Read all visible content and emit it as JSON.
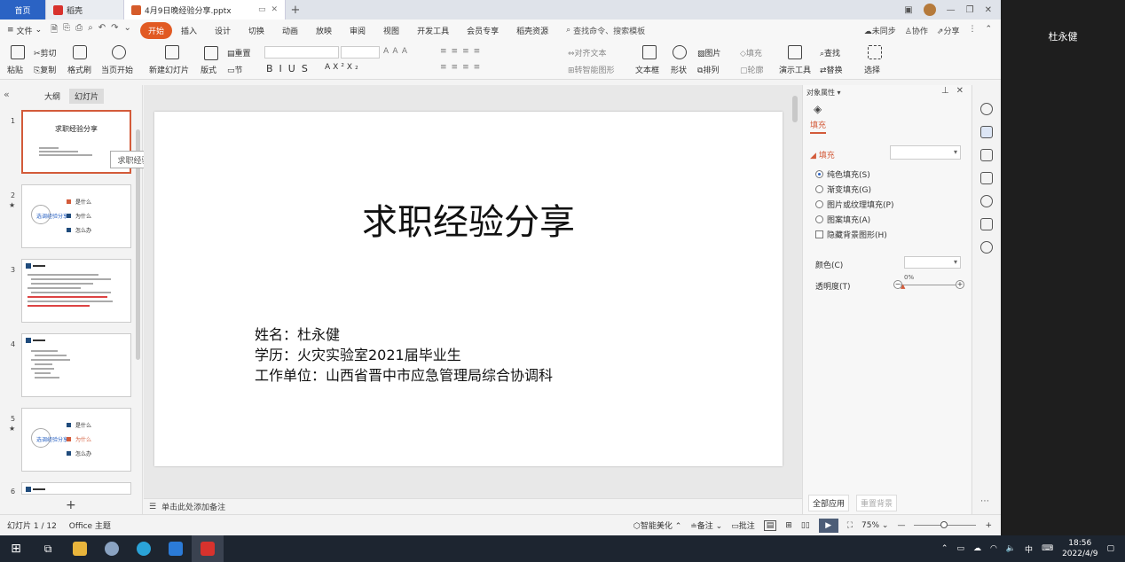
{
  "tabs": {
    "home": "首页",
    "doc1": "稻壳",
    "doc2": "4月9日晚经验分享.pptx"
  },
  "menu": {
    "file": "文件",
    "items": [
      "开始",
      "插入",
      "设计",
      "切换",
      "动画",
      "放映",
      "审阅",
      "视图",
      "开发工具",
      "会员专享",
      "稻壳资源"
    ],
    "search": "查找命令、搜索模板",
    "sync": "未同步",
    "collab": "协作",
    "share": "分享"
  },
  "ribbon": {
    "paste": "粘贴",
    "cut": "剪切",
    "copy": "复制",
    "format_painter": "格式刷",
    "from_current": "当页开始",
    "new_slide": "新建幻灯片",
    "layout": "版式",
    "section": "节",
    "reset": "重置",
    "align_text": "对齐文本",
    "convert_smartart": "转智能图形",
    "textbox": "文本框",
    "shape": "形状",
    "arrange": "排列",
    "picture": "图片",
    "fill": "填充",
    "outline": "轮廓",
    "presenter_tools": "演示工具",
    "find": "查找",
    "replace": "替换",
    "select": "选择"
  },
  "left_panel": {
    "tab_outline": "大纲",
    "tab_slides": "幻灯片",
    "tooltip": "求职经验分享",
    "slide_numbers": [
      "1",
      "2",
      "3",
      "4",
      "5",
      "6"
    ],
    "thumb1_title": "求职经验分享",
    "thumb2_items": [
      "是什么",
      "为什么",
      "怎么办"
    ],
    "thumb2_center": "选调经验分享"
  },
  "slide": {
    "title": "求职经验分享",
    "name": "姓名：杜永健",
    "education": "学历：火灾实验室2021届毕业生",
    "work": "工作单位：山西省晋中市应急管理局综合协调科"
  },
  "notes_placeholder": "单击此处添加备注",
  "properties": {
    "header": "对象属性",
    "tab_fill": "填充",
    "section_fill": "填充",
    "options": [
      "纯色填充(S)",
      "渐变填充(G)",
      "图片或纹理填充(P)",
      "图案填充(A)"
    ],
    "hide_bg": "隐藏背景图形(H)",
    "color_label": "颜色(C)",
    "transparency_label": "透明度(T)",
    "transparency_value": "0%",
    "apply_all": "全部应用",
    "reset_bg": "重置背景"
  },
  "status": {
    "slide_pos": "幻灯片 1 / 12",
    "theme": "Office 主题",
    "beautify": "智能美化",
    "notes": "备注",
    "comments": "批注",
    "zoom": "75%"
  },
  "right_user": "杜永健",
  "taskbar": {
    "time": "18:56",
    "date": "2022/4/9",
    "ime": "中"
  }
}
